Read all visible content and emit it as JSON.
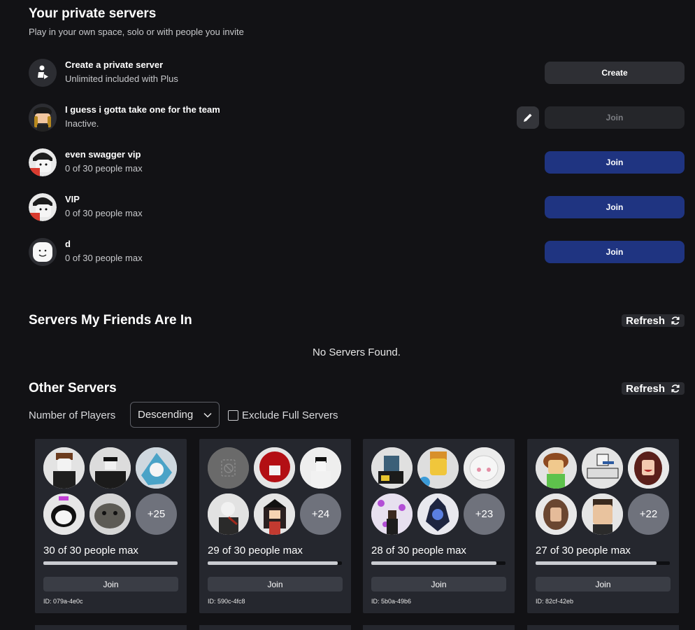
{
  "private_servers": {
    "title": "Your private servers",
    "subtitle": "Play in your own space, solo or with people you invite",
    "create_row": {
      "name": "Create a private server",
      "meta": "Unlimited included with Plus",
      "button": "Create"
    },
    "rows": [
      {
        "name": "I guess i gotta take one for the team",
        "meta": "Inactive.",
        "button": "Join"
      },
      {
        "name": "even swagger vip",
        "meta": "0 of 30 people max",
        "button": "Join"
      },
      {
        "name": "VIP",
        "meta": "0 of 30 people max",
        "button": "Join"
      },
      {
        "name": "d",
        "meta": "0 of 30 people max",
        "button": "Join"
      }
    ]
  },
  "friends_servers": {
    "title": "Servers My Friends Are In",
    "refresh": "Refresh",
    "empty": "No Servers Found."
  },
  "other_servers": {
    "title": "Other Servers",
    "refresh": "Refresh",
    "sort_label": "Number of Players",
    "sort_value": "Descending",
    "exclude_label": "Exclude Full Servers",
    "cards": [
      {
        "more": "+25",
        "count": "30 of 30 people max",
        "fill": 1.0,
        "join": "Join",
        "id": "ID: 079a-4e0c"
      },
      {
        "more": "+24",
        "count": "29 of 30 people max",
        "fill": 0.967,
        "join": "Join",
        "id": "ID: 590c-4fc8"
      },
      {
        "more": "+23",
        "count": "28 of 30 people max",
        "fill": 0.933,
        "join": "Join",
        "id": "ID: 5b0a-49b6"
      },
      {
        "more": "+22",
        "count": "27 of 30 people max",
        "fill": 0.9,
        "join": "Join",
        "id": "ID: 82cf-42eb"
      }
    ]
  },
  "colors": {
    "background": "#121215",
    "join_blue": "#1f3481",
    "card": "#25272e"
  }
}
